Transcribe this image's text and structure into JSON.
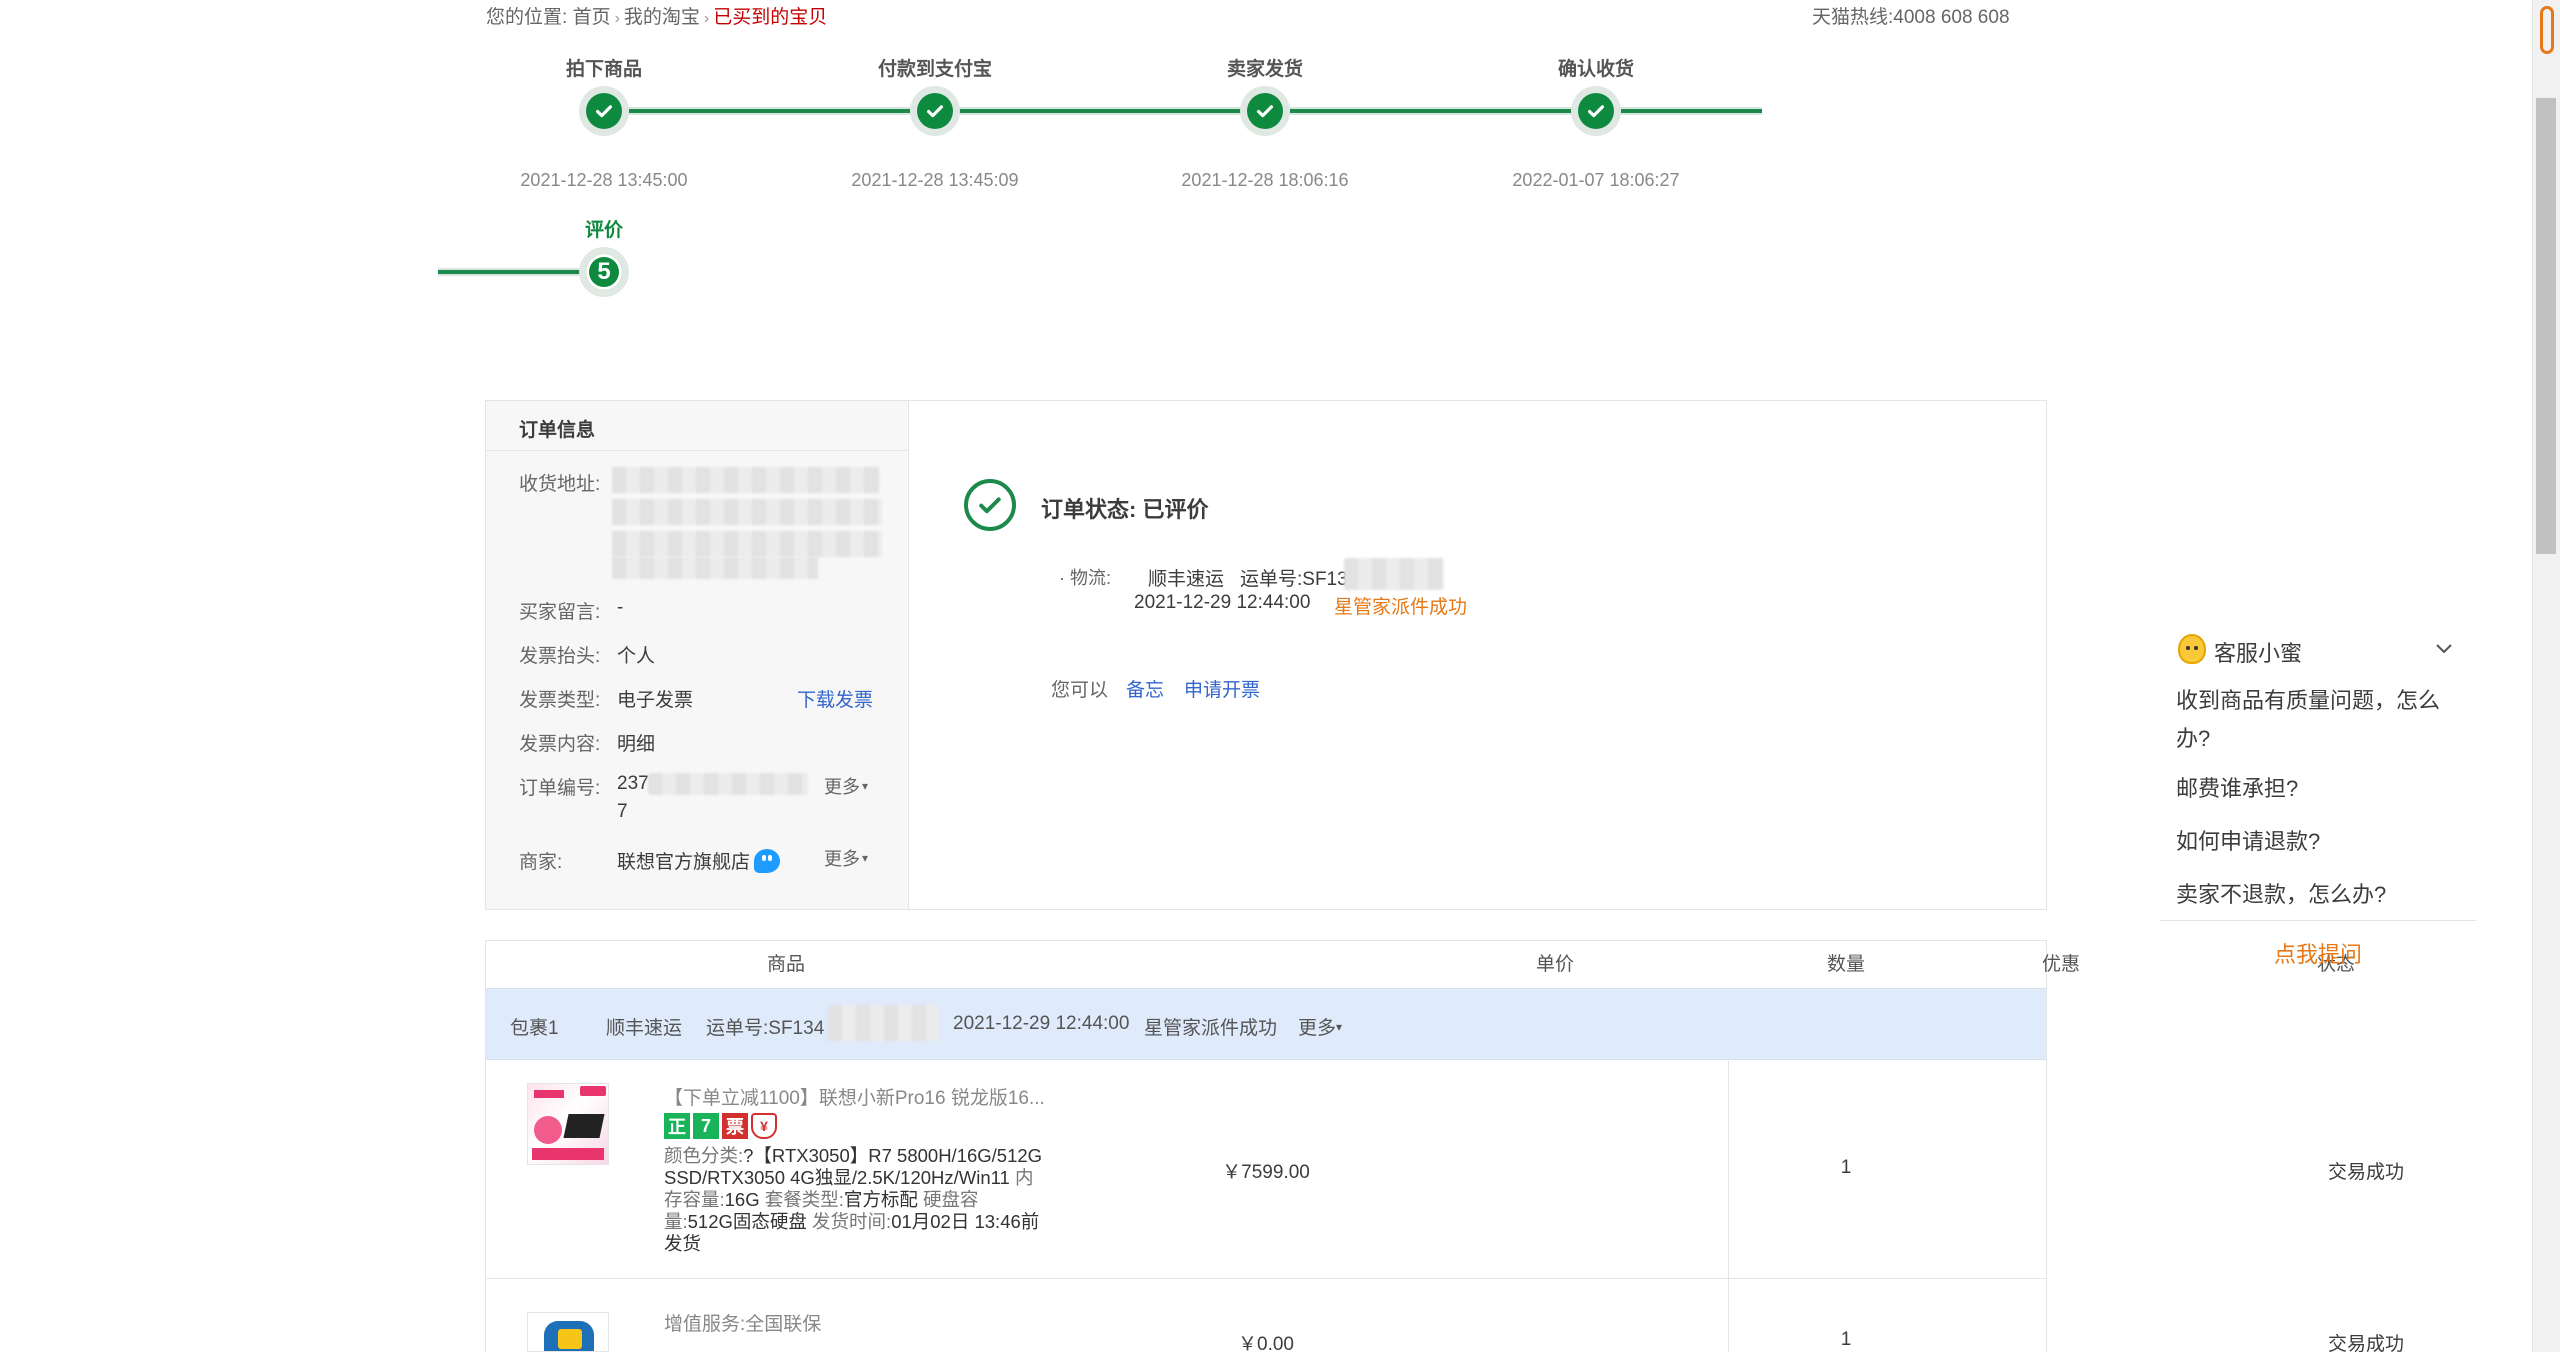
{
  "breadcrumb": {
    "prefix": "您的位置:",
    "items": [
      "首页",
      "我的淘宝"
    ],
    "current": "已买到的宝贝"
  },
  "hotline": "天猫热线:4008 608 608",
  "progress": {
    "steps": [
      {
        "label": "拍下商品",
        "time": "2021-12-28 13:45:00"
      },
      {
        "label": "付款到支付宝",
        "time": "2021-12-28 13:45:09"
      },
      {
        "label": "卖家发货",
        "time": "2021-12-28 18:06:16"
      },
      {
        "label": "确认收货",
        "time": "2022-01-07 18:06:27"
      },
      {
        "label": "评价",
        "number": "5"
      }
    ]
  },
  "order_info": {
    "title": "订单信息",
    "address_label": "收货地址:",
    "message_label": "买家留言:",
    "message_value": "-",
    "invoice_title_label": "发票抬头:",
    "invoice_title_value": "个人",
    "invoice_type_label": "发票类型:",
    "invoice_type_value": "电子发票",
    "download_invoice": "下载发票",
    "invoice_content_label": "发票内容:",
    "invoice_content_value": "明细",
    "order_no_label": "订单编号:",
    "order_no_prefix": "237",
    "order_no_suffix": "7",
    "more": "更多",
    "merchant_label": "商家:",
    "merchant_value": "联想官方旗舰店"
  },
  "status": {
    "title": "订单状态: 已评价",
    "logistics_label": "· 物流:",
    "carrier": "顺丰速运",
    "tracking_label": "运单号:SF13",
    "log_time": "2021-12-29 12:44:00",
    "log_event": "星管家派件成功",
    "you_can": "您可以",
    "action_note": "备忘",
    "action_invoice": "申请开票"
  },
  "table": {
    "headers": [
      "商品",
      "单价",
      "数量",
      "优惠",
      "状态"
    ],
    "package": {
      "name": "包裹1",
      "carrier": "顺丰速运",
      "tracking": "运单号:SF134",
      "time": "2021-12-29 12:44:00",
      "event": "星管家派件成功",
      "more": "更多"
    },
    "items": [
      {
        "name": "【下单立减1100】联想小新Pro16 锐龙版16...",
        "badges": [
          "正",
          "7",
          "票",
          "¥"
        ],
        "desc_label1": "颜色分类:",
        "desc_value1": "?【RTX3050】R7 5800H/16G/512G SSD/RTX3050 4G独显/2.5K/120Hz/Win11",
        "desc_label2": "内存容量:",
        "desc_value2": "16G",
        "desc_label3": "套餐类型:",
        "desc_value3": "官方标配",
        "desc_label4": "硬盘容量:",
        "desc_value4": "512G固态硬盘",
        "desc_label5": "发货时间:",
        "desc_value5": "01月02日 13:46前发货",
        "price": "￥7599.00",
        "qty": "1",
        "status": "交易成功"
      },
      {
        "name": "增值服务:全国联保",
        "price": "￥0.00",
        "qty": "1",
        "status": "交易成功"
      }
    ]
  },
  "chat": {
    "title": "客服小蜜",
    "questions": [
      "收到商品有质量问题，怎么办?",
      "邮费谁承担?",
      "如何申请退款?",
      "卖家不退款，怎么办?"
    ],
    "ask": "点我提问"
  },
  "colors": {
    "progress_green": "#0d8a3e",
    "current_crumb": "#c40000",
    "link": "#3366cc",
    "orange": "#e67817",
    "package_row_bg": "#dfeafb"
  }
}
